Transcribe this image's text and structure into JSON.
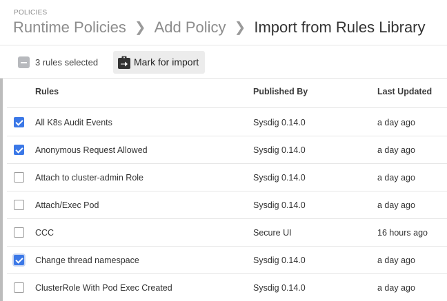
{
  "header": {
    "eyebrow": "POLICIES",
    "breadcrumb": [
      "Runtime Policies",
      "Add Policy",
      "Import from Rules Library"
    ]
  },
  "toolbar": {
    "selection_text": "3 rules selected",
    "mark_label": "Mark for import",
    "mark_icon": "clipboard-arrow-icon"
  },
  "table": {
    "columns": [
      "Rules",
      "Published By",
      "Last Updated"
    ],
    "rows": [
      {
        "rule": "All K8s Audit Events",
        "published_by": "Sysdig 0.14.0",
        "last_updated": "a day ago",
        "checked": true
      },
      {
        "rule": "Anonymous Request Allowed",
        "published_by": "Sysdig 0.14.0",
        "last_updated": "a day ago",
        "checked": true
      },
      {
        "rule": "Attach to cluster-admin Role",
        "published_by": "Sysdig 0.14.0",
        "last_updated": "a day ago",
        "checked": false
      },
      {
        "rule": "Attach/Exec Pod",
        "published_by": "Sysdig 0.14.0",
        "last_updated": "a day ago",
        "checked": false
      },
      {
        "rule": "CCC",
        "published_by": "Secure UI",
        "last_updated": "16 hours ago",
        "checked": false
      },
      {
        "rule": "Change thread namespace",
        "published_by": "Sysdig 0.14.0",
        "last_updated": "a day ago",
        "checked": true
      },
      {
        "rule": "ClusterRole With Pod Exec Created",
        "published_by": "Sysdig 0.14.0",
        "last_updated": "a day ago",
        "checked": false
      }
    ]
  },
  "colors": {
    "accent": "#3b78e7",
    "button_bg": "#ececec",
    "muted_text": "#8c8c8c"
  }
}
